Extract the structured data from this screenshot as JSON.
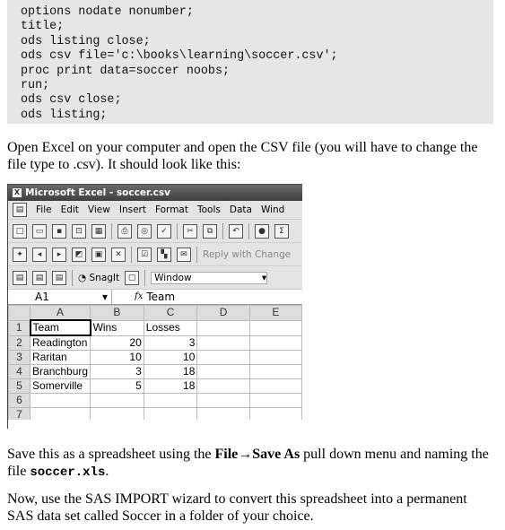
{
  "code": [
    "options nodate nonumber;",
    "title;",
    "ods listing close;",
    "ods csv file='c:\\books\\learning\\soccer.csv';",
    "proc print data=soccer noobs;",
    "run;",
    "ods csv close;",
    "ods listing;"
  ],
  "para1": "Open Excel on your computer and open the CSV file (you will have to change the file type to .csv). It should look like this:",
  "excel": {
    "title": "Microsoft Excel - soccer.csv",
    "menu": [
      "File",
      "Edit",
      "View",
      "Insert",
      "Format",
      "Tools",
      "Data",
      "Wind"
    ],
    "reply": "Reply with Change",
    "snagit": "SnagIt",
    "window_select": "Window",
    "name_box": "A1",
    "fx": "fx",
    "formula": "Team",
    "columns": [
      "A",
      "B",
      "C",
      "D",
      "E"
    ],
    "rows": [
      {
        "n": "1",
        "a": "Team",
        "b": "Wins",
        "c": "Losses"
      },
      {
        "n": "2",
        "a": "Readington",
        "b": "20",
        "c": "3"
      },
      {
        "n": "3",
        "a": "Raritan",
        "b": "10",
        "c": "10"
      },
      {
        "n": "4",
        "a": "Branchburg",
        "b": "3",
        "c": "18"
      },
      {
        "n": "5",
        "a": "Somerville",
        "b": "5",
        "c": "18"
      },
      {
        "n": "6",
        "a": "",
        "b": "",
        "c": ""
      },
      {
        "n": "7",
        "a": "",
        "b": "",
        "c": ""
      }
    ]
  },
  "para2": {
    "pre": "Save this as a spreadsheet using the ",
    "bold": "File→Save As",
    "mid": " pull down menu and naming the file ",
    "code": "soccer.xls",
    "post": "."
  },
  "para3": "Now, use the SAS IMPORT wizard to convert this spreadsheet into a permanent SAS data set called Soccer in a folder of your choice."
}
